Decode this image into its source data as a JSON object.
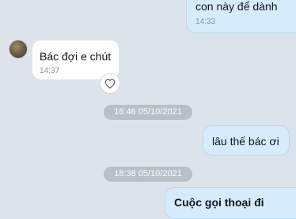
{
  "messages": [
    {
      "id": "m1",
      "direction": "outgoing",
      "text": "con này để dành",
      "time": "14:33"
    },
    {
      "id": "m2",
      "direction": "incoming",
      "text": "Bác đợi e chút",
      "time": "14:37"
    },
    {
      "id": "m3",
      "direction": "outgoing",
      "text": "lâu thế bác ơi"
    },
    {
      "id": "m4",
      "direction": "outgoing",
      "text": "Cuộc gọi thoại đi"
    }
  ],
  "date_separators": [
    {
      "label": "16:46 05/10/2021"
    },
    {
      "label": "18:38 05/10/2021"
    }
  ],
  "icons": {
    "avatar": "contact-avatar",
    "reaction": "heart-outline-icon"
  },
  "colors": {
    "background": "#dde3ea",
    "outgoing_bubble": "#d6ecfd",
    "incoming_bubble": "#ffffff",
    "date_pill": "#b9bfc7"
  }
}
